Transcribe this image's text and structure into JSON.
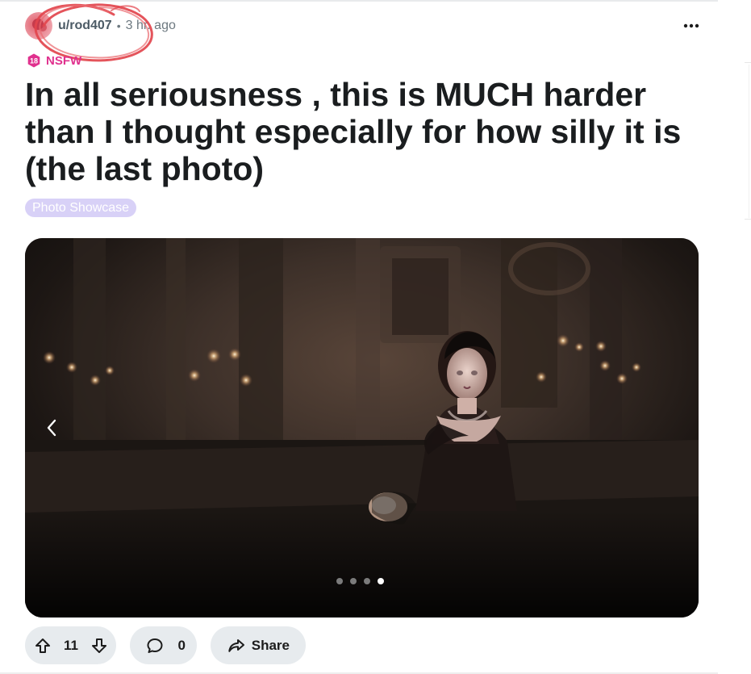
{
  "post": {
    "author": "u/rod407",
    "separator": "•",
    "time": "3 hr. ago",
    "nsfw_badge": "18",
    "nsfw_label": "NSFW",
    "title": "In all seriousness , this is MUCH harder than I thought especially for how silly it is (the last photo)",
    "flair": "Photo Showcase"
  },
  "gallery": {
    "image_count": 4,
    "active_index": 4
  },
  "actions": {
    "upvotes": "11",
    "comments": "0",
    "share_label": "Share"
  },
  "icons": {
    "more": "more-horizontal-icon",
    "nsfw": "nsfw-18-icon",
    "prev": "chevron-left-icon",
    "upvote": "upvote-arrow-icon",
    "downvote": "downvote-arrow-icon",
    "comment": "comment-bubble-icon",
    "share": "share-arrow-icon"
  },
  "colors": {
    "nsfw": "#e0318e",
    "flair_bg": "#d8d1f7",
    "action_bg": "#e7ebee",
    "annotation": "#e2454d"
  }
}
